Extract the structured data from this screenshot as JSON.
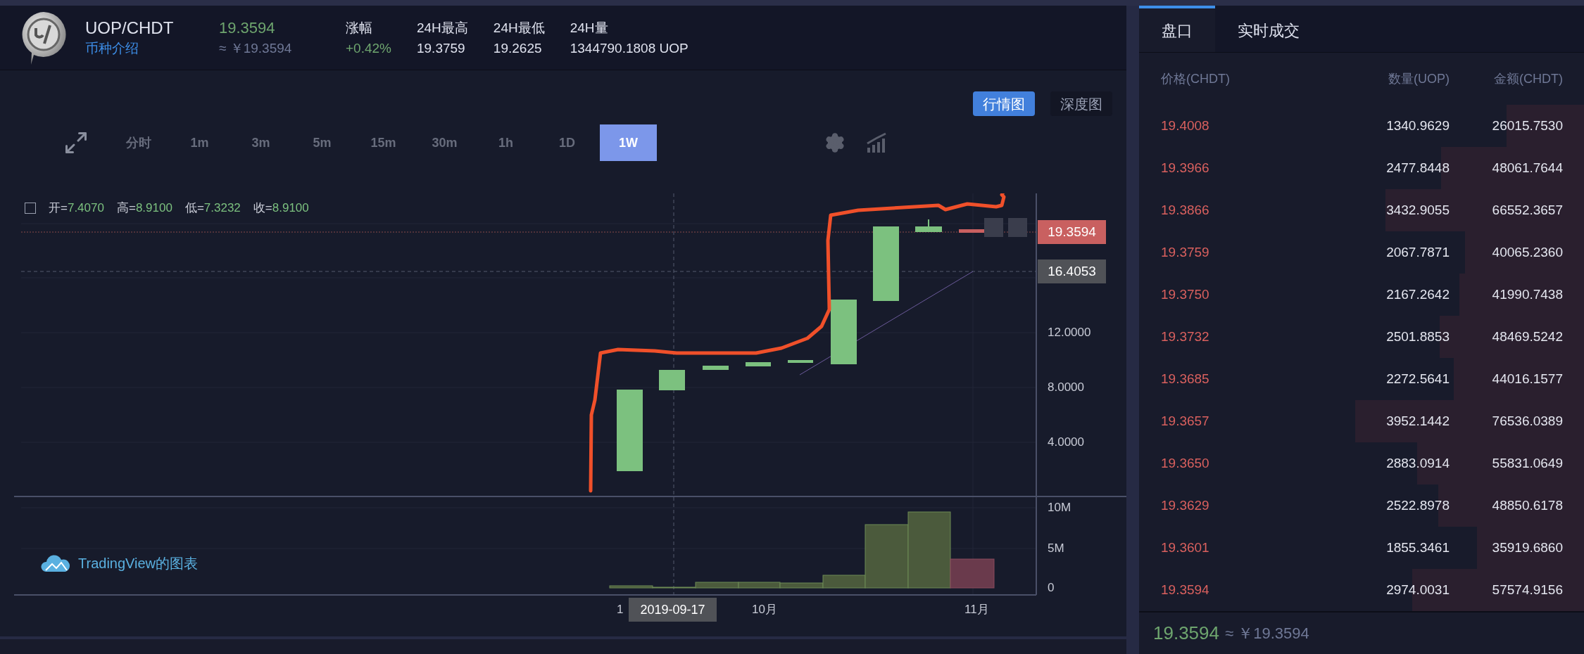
{
  "header": {
    "pair": "UOP/CHDT",
    "intro_link": "币种介绍",
    "price": "19.3594",
    "price_cny": "≈ ￥19.3594",
    "stats": [
      {
        "label": "涨幅",
        "value": "+0.42%",
        "kind": "change"
      },
      {
        "label": "24H最高",
        "value": "19.3759",
        "kind": "plain"
      },
      {
        "label": "24H最低",
        "value": "19.2625",
        "kind": "plain"
      },
      {
        "label": "24H量",
        "value": "1344790.1808 UOP",
        "kind": "plain"
      }
    ]
  },
  "view_toggle": [
    {
      "label": "行情图",
      "selected": true
    },
    {
      "label": "深度图",
      "selected": false
    }
  ],
  "intervals": [
    {
      "label": "分时",
      "selected": false
    },
    {
      "label": "1m",
      "selected": false
    },
    {
      "label": "3m",
      "selected": false
    },
    {
      "label": "5m",
      "selected": false
    },
    {
      "label": "15m",
      "selected": false
    },
    {
      "label": "30m",
      "selected": false
    },
    {
      "label": "1h",
      "selected": false
    },
    {
      "label": "1D",
      "selected": false
    },
    {
      "label": "1W",
      "selected": true
    }
  ],
  "chart": {
    "ohlc": [
      {
        "label": "开=",
        "value": "7.4070"
      },
      {
        "label": "高=",
        "value": "8.9100"
      },
      {
        "label": "低=",
        "value": "7.3232"
      },
      {
        "label": "收=",
        "value": "8.9100"
      }
    ],
    "price_axis": [
      "12.0000",
      "8.0000",
      "4.0000"
    ],
    "price_tags": [
      {
        "value": "19.3594",
        "kind": "last"
      },
      {
        "value": "16.4053",
        "kind": "crosshair"
      }
    ],
    "volume_axis": [
      "10M",
      "5M",
      "0"
    ],
    "time_axis": [
      "1",
      "10月",
      "11月"
    ],
    "crosshair_date": "2019-09-17",
    "watermark": "TradingView的图表"
  },
  "order_book": {
    "tabs": [
      {
        "label": "盘口",
        "selected": true
      },
      {
        "label": "实时成交",
        "selected": false
      }
    ],
    "columns": [
      "价格(CHDT)",
      "数量(UOP)",
      "金额(CHDT)"
    ],
    "rows": [
      {
        "price": "19.4008",
        "amount": "1340.9629",
        "total": "26015.7530"
      },
      {
        "price": "19.3966",
        "amount": "2477.8448",
        "total": "48061.7644"
      },
      {
        "price": "19.3866",
        "amount": "3432.9055",
        "total": "66552.3657"
      },
      {
        "price": "19.3759",
        "amount": "2067.7871",
        "total": "40065.2360"
      },
      {
        "price": "19.3750",
        "amount": "2167.2642",
        "total": "41990.7438"
      },
      {
        "price": "19.3732",
        "amount": "2501.8853",
        "total": "48469.5242"
      },
      {
        "price": "19.3685",
        "amount": "2272.5641",
        "total": "44016.1577"
      },
      {
        "price": "19.3657",
        "amount": "3952.1442",
        "total": "76536.0389"
      },
      {
        "price": "19.3650",
        "amount": "2883.0914",
        "total": "55831.0649"
      },
      {
        "price": "19.3629",
        "amount": "2522.8978",
        "total": "48850.6178"
      },
      {
        "price": "19.3601",
        "amount": "1855.3461",
        "total": "35919.6860"
      },
      {
        "price": "19.3594",
        "amount": "2974.0031",
        "total": "57574.9156"
      }
    ],
    "footer": {
      "price": "19.3594",
      "price_cny": "≈ ￥19.3594"
    }
  }
}
